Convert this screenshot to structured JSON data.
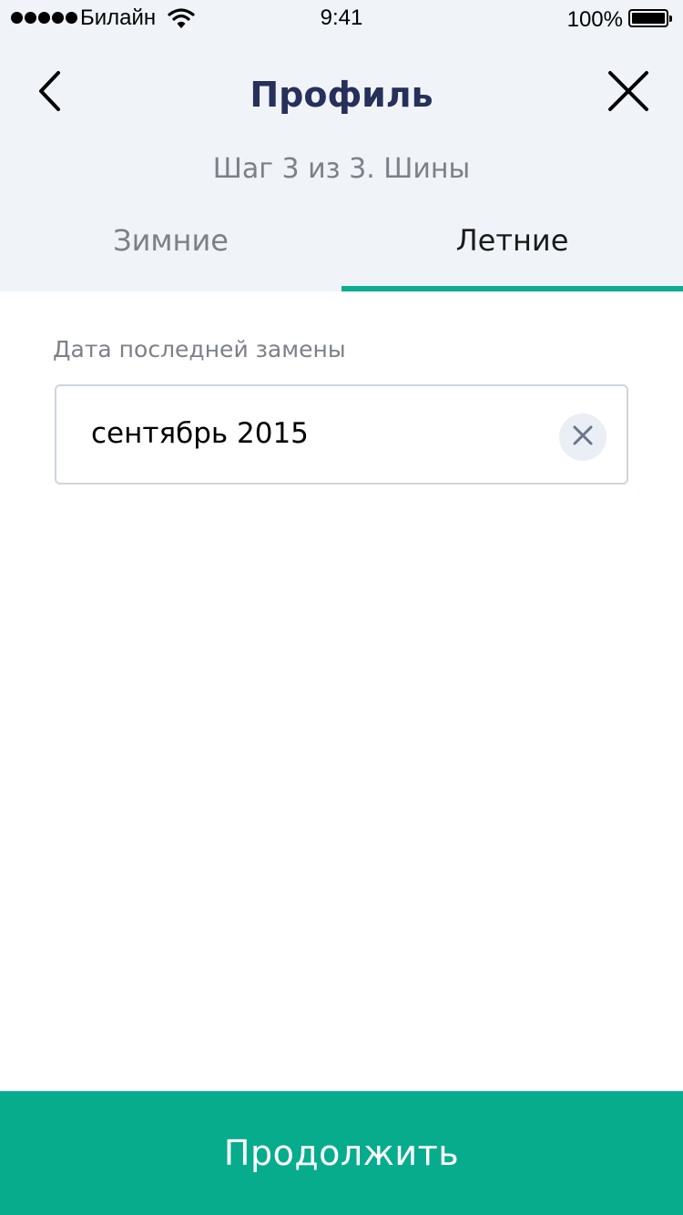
{
  "status_bar": {
    "carrier": "Билайн",
    "time": "9:41",
    "battery": "100%",
    "signal_bars": 5,
    "battery_level": 1.0,
    "icons": [
      "signal-dots-icon",
      "wifi-icon",
      "battery-icon"
    ]
  },
  "nav": {
    "title": "Профиль",
    "subtitle": "Шаг 3 из 3. Шины",
    "back_icon": "chevron-left-icon",
    "close_icon": "close-icon"
  },
  "tabs": {
    "items": [
      {
        "label": "Зимние",
        "active": false
      },
      {
        "label": "Летние",
        "active": true
      }
    ]
  },
  "form": {
    "date_label": "Дата последней замены",
    "date_value": "сентябрь 2015",
    "clear_icon": "clear-icon"
  },
  "footer": {
    "continue_label": "Продолжить"
  },
  "colors": {
    "accent": "#07ac8d",
    "title": "#26305a",
    "muted_text": "#7c8087",
    "header_bg": "#f0f4f9",
    "field_border": "#cfd5de",
    "clear_bg": "#eaeef5",
    "clear_icon": "#6b7689"
  }
}
